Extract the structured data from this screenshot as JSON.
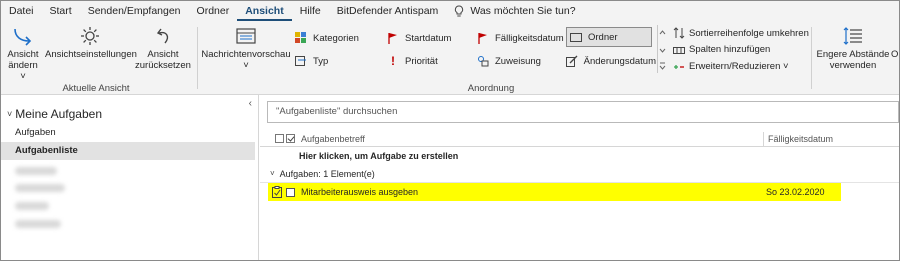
{
  "menu": {
    "tabs": [
      "Datei",
      "Start",
      "Senden/Empfangen",
      "Ordner",
      "Ansicht",
      "Hilfe",
      "BitDefender Antispam"
    ],
    "active_tab": "Ansicht",
    "tell_me": "Was möchten Sie tun?"
  },
  "ribbon": {
    "current_view": {
      "change_view_l1": "Ansicht",
      "change_view_l2": "ändern",
      "view_settings": "Ansichtseinstellungen",
      "reset_view_l1": "Ansicht",
      "reset_view_l2": "zurücksetzen",
      "group_label": "Aktuelle Ansicht"
    },
    "layout": {
      "reading_pane": "Nachrichtenvorschau"
    },
    "arrangement": {
      "gallery": [
        "Kategorien",
        "Startdatum",
        "Fälligkeitsdatum",
        "Ordner",
        "Typ",
        "Priorität",
        "Zuweisung",
        "Änderungsdatum"
      ],
      "selected": "Ordner",
      "reverse_sort": "Sortierreihenfolge umkehren",
      "add_columns": "Spalten hinzufügen",
      "expand_collapse": "Erweitern/Reduzieren",
      "group_label": "Anordnung"
    },
    "spacing": {
      "tighter_l1": "Engere Abstände",
      "tighter_l2": "verwenden",
      "cut_label": "O"
    }
  },
  "nav": {
    "root": "Meine Aufgaben",
    "items": [
      "Aufgaben",
      "Aufgabenliste"
    ],
    "selected": "Aufgabenliste"
  },
  "content": {
    "search_placeholder": "\"Aufgabenliste\" durchsuchen",
    "columns": {
      "subject": "Aufgabenbetreff",
      "due": "Fälligkeitsdatum"
    },
    "new_task": "Hier klicken, um Aufgabe zu erstellen",
    "group_header": "Aufgaben: 1 Element(e)",
    "tasks": [
      {
        "subject": "Mitarbeiterausweis ausgeben",
        "due": "So 23.02.2020",
        "highlight": "#ffff00"
      }
    ]
  },
  "colors": {
    "accent": "#1e4e79",
    "highlight": "#ffff00",
    "ribbon_bg": "#f3f3f3"
  }
}
